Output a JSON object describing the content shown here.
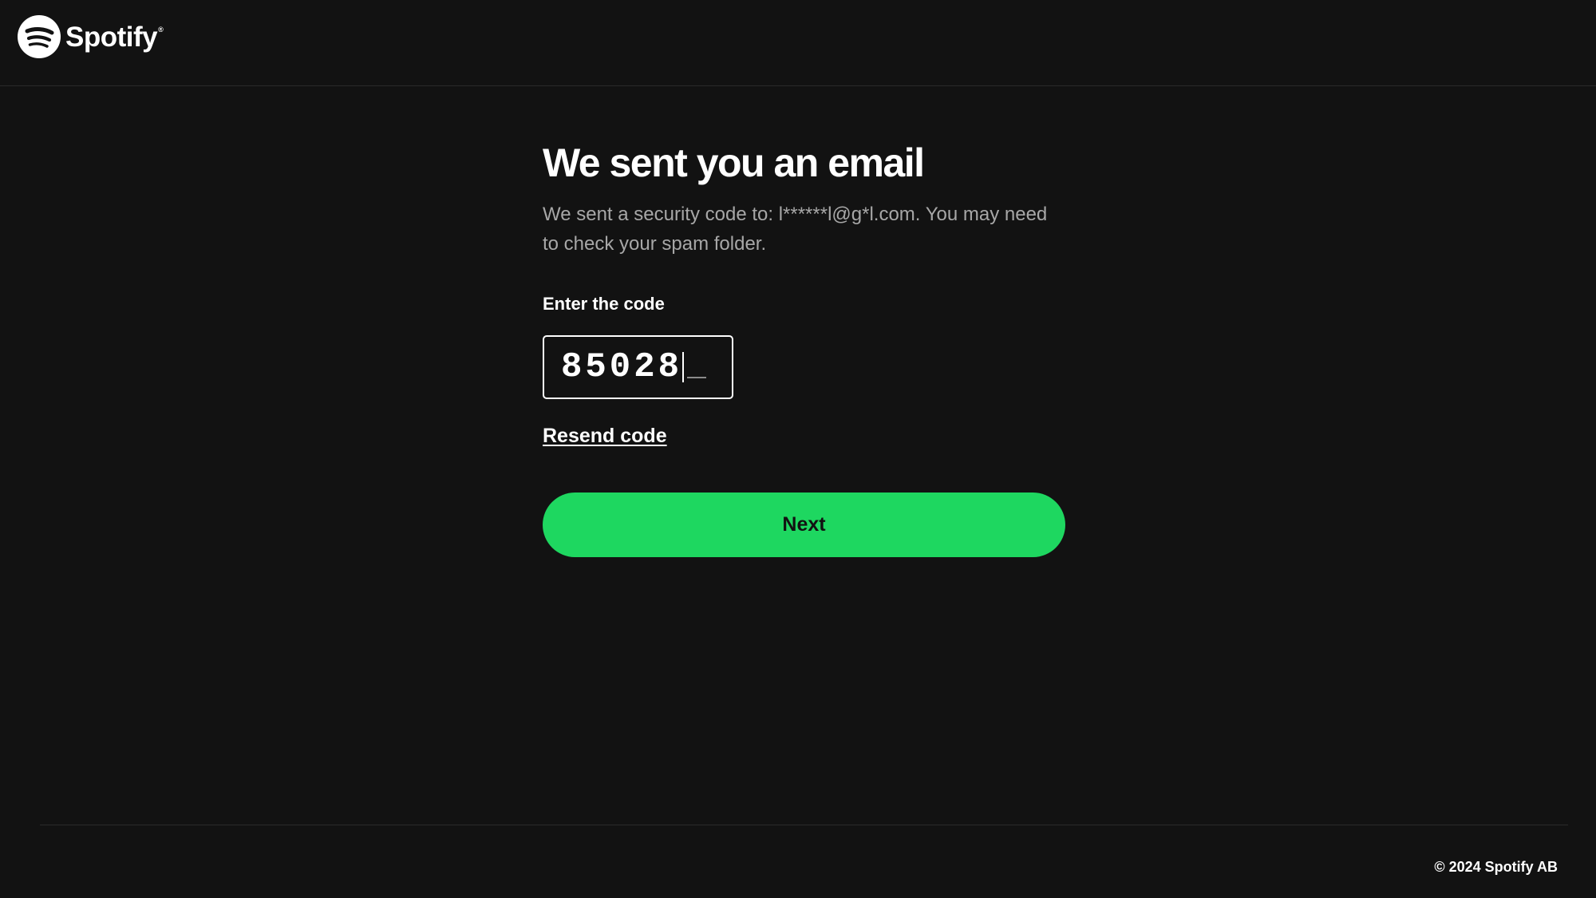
{
  "header": {
    "logo_text": "Spotify",
    "logo_reg": "®"
  },
  "main": {
    "title": "We sent you an email",
    "subtitle": "We sent a security code to: l******l@g*l.com. You may need to check your spam folder.",
    "code_label": "Enter the code",
    "code_value": "85028",
    "resend_label": "Resend code",
    "next_label": "Next"
  },
  "footer": {
    "copyright": "© 2024 Spotify AB"
  },
  "colors": {
    "background": "#121212",
    "accent": "#1ed760",
    "muted_text": "#a7a7a7"
  },
  "icons": {
    "logo": "spotify-logo-icon"
  }
}
